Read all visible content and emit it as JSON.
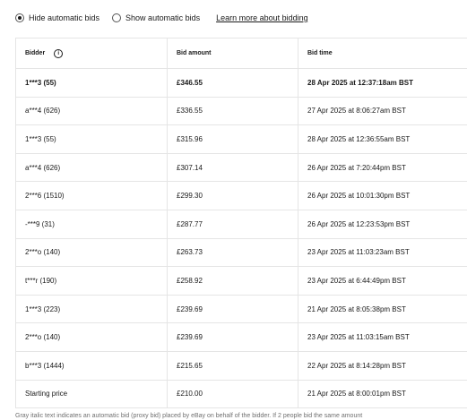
{
  "controls": {
    "hide_label": "Hide automatic bids",
    "show_label": "Show automatic bids",
    "selected": "hide",
    "learn_more": "Learn more about bidding"
  },
  "table": {
    "headers": {
      "bidder": "Bidder",
      "amount": "Bid amount",
      "time": "Bid time"
    },
    "info_icon": "info-icon",
    "rows": [
      {
        "bidder": "1***3 (55)",
        "amount": "£346.55",
        "time": "28 Apr 2025 at 12:37:18am BST",
        "leading": true
      },
      {
        "bidder": "a***4 (626)",
        "amount": "£336.55",
        "time": "27 Apr 2025 at 8:06:27am BST"
      },
      {
        "bidder": "1***3 (55)",
        "amount": "£315.96",
        "time": "28 Apr 2025 at 12:36:55am BST"
      },
      {
        "bidder": "a***4 (626)",
        "amount": "£307.14",
        "time": "26 Apr 2025 at 7:20:44pm BST"
      },
      {
        "bidder": "2***6 (1510)",
        "amount": "£299.30",
        "time": "26 Apr 2025 at 10:01:30pm BST"
      },
      {
        "bidder": "-***9 (31)",
        "amount": "£287.77",
        "time": "26 Apr 2025 at 12:23:53pm BST"
      },
      {
        "bidder": "2***o (140)",
        "amount": "£263.73",
        "time": "23 Apr 2025 at 11:03:23am BST"
      },
      {
        "bidder": "t***r (190)",
        "amount": "£258.92",
        "time": "23 Apr 2025 at 6:44:49pm BST"
      },
      {
        "bidder": "1***3 (223)",
        "amount": "£239.69",
        "time": "21 Apr 2025 at 8:05:38pm BST"
      },
      {
        "bidder": "2***o (140)",
        "amount": "£239.69",
        "time": "23 Apr 2025 at 11:03:15am BST"
      },
      {
        "bidder": "b***3 (1444)",
        "amount": "£215.65",
        "time": "22 Apr 2025 at 8:14:28pm BST"
      },
      {
        "bidder": "Starting price",
        "amount": "£210.00",
        "time": "21 Apr 2025 at 8:00:01pm BST"
      }
    ]
  },
  "footnote": "Gray italic text indicates an automatic bid (proxy bid) placed by eBay on behalf of the bidder. If 2 people bid the same amount"
}
